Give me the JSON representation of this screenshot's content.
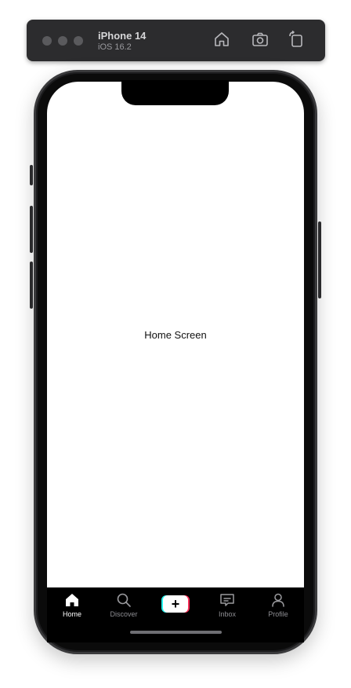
{
  "simulator": {
    "device_name": "iPhone 14",
    "os_version": "iOS 16.2",
    "toolbar_icons": [
      "home-icon",
      "screenshot-icon",
      "rotate-icon"
    ]
  },
  "screen": {
    "title": "Home Screen"
  },
  "tabbar": {
    "items": [
      {
        "label": "Home",
        "icon": "home-icon",
        "active": true
      },
      {
        "label": "Discover",
        "icon": "search-icon",
        "active": false
      },
      {
        "label": "",
        "icon": "plus-icon",
        "active": false
      },
      {
        "label": "Inbox",
        "icon": "message-icon",
        "active": false
      },
      {
        "label": "Profile",
        "icon": "person-icon",
        "active": false
      }
    ]
  },
  "colors": {
    "create_cyan": "#25f4ee",
    "create_red": "#fe2c55",
    "tabbar_bg": "#000000",
    "active_label": "#ffffff",
    "inactive_label": "#8e8e93"
  }
}
